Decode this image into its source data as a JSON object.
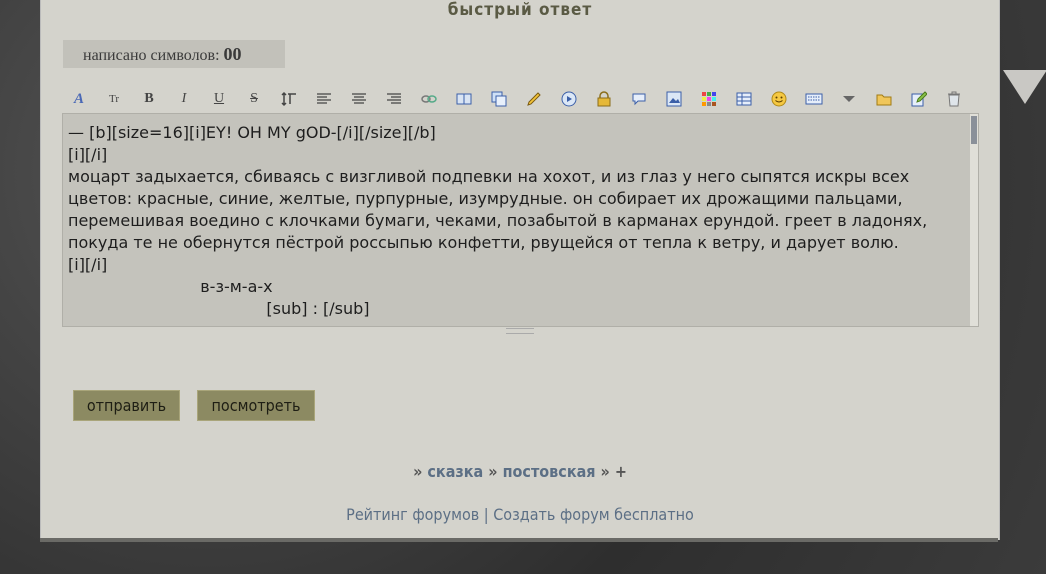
{
  "form": {
    "title": "быстрый ответ",
    "counter_label": "написано символов: ",
    "counter_value": "00",
    "editor_text": "— [b][size=16][i]EY! OH MY gOD-[/i][/size][/b]\n[i][/i]\nмоцарт задыхается, сбиваясь с визгливой подпевки на хохот, и из глаз у него сыпятся искры всех цветов: красные, синие, желтые, пурпурные, изумрудные. он собирает их дрожащими пальцами, перемешивая воедино с клочками бумаги, чеками, позабытой в карманах ерундой. греет в ладонях, покуда те не обернутся пёстрой россыпью конфетти, рвущейся от тепла к ветру, и дарует волю.\n[i][/i]\n                          в-з-м-а-х\n                                       [sub] : [/sub]",
    "submit_label": "отправить",
    "preview_label": "посмотреть"
  },
  "toolbar": {
    "font": "A",
    "size": "Tr",
    "bold": "B",
    "italic": "I",
    "underline": "U",
    "strike": "S",
    "icons": [
      "font-icon",
      "size-icon",
      "bold-icon",
      "italic-icon",
      "underline-icon",
      "strike-icon",
      "line-height-icon",
      "align-left-icon",
      "align-center-icon",
      "align-right-icon",
      "link-icon",
      "book-icon",
      "copy-icon",
      "pencil-icon",
      "play-icon",
      "lock-icon",
      "speech-bubble-icon",
      "image-icon",
      "color-icon",
      "table-icon",
      "smiley-icon",
      "keyboard-icon",
      "dropdown-icon",
      "folder-icon",
      "edit-icon",
      "clear-icon"
    ]
  },
  "breadcrumbs": {
    "sep1": "» ",
    "item1": "сказка",
    "sep2": " » ",
    "item2": "постовская",
    "sep3": " » +"
  },
  "footer": {
    "rating": "Рейтинг форумов",
    "divider": " | ",
    "create": "Создать форум бесплатно"
  },
  "colors": {
    "panel": "#d4d3cc",
    "button": "#8c8a62",
    "link": "#5c6f85"
  }
}
